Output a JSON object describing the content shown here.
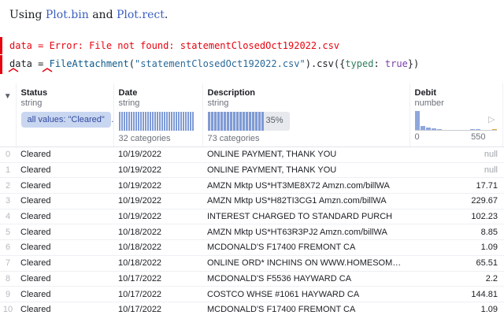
{
  "intro": {
    "prefix": "Using ",
    "link1": "Plot.bin",
    "middle": " and ",
    "link2": "Plot.rect",
    "suffix": "."
  },
  "error_cell": {
    "message": "data = Error: File not found: statementClosedOct192022.csv"
  },
  "code_cell": {
    "var": "data",
    "eq": " = ",
    "fn": "FileAttachment",
    "open": "(",
    "str": "\"statementClosedOct192022.csv\"",
    "mid": ").csv({",
    "key": "typed",
    "colon": ": ",
    "kw": "true",
    "close": "})"
  },
  "table": {
    "columns": [
      {
        "name": "Status",
        "type": "string",
        "summary_pill": "all values: \"Cleared\""
      },
      {
        "name": "Date",
        "type": "string",
        "summary": "32 categories"
      },
      {
        "name": "Description",
        "type": "string",
        "summary": "73 categories",
        "top_share_label": "35%",
        "top_share": 0.35
      },
      {
        "name": "Debit",
        "type": "number",
        "hist_min": "0",
        "hist_max": "550"
      }
    ],
    "rows": [
      {
        "idx": "0",
        "status": "Cleared",
        "date": "10/19/2022",
        "desc": "ONLINE PAYMENT, THANK YOU",
        "debit": "null"
      },
      {
        "idx": "1",
        "status": "Cleared",
        "date": "10/19/2022",
        "desc": "ONLINE PAYMENT, THANK YOU",
        "debit": "null"
      },
      {
        "idx": "2",
        "status": "Cleared",
        "date": "10/19/2022",
        "desc": "AMZN Mktp US*HT3ME8X72 Amzn.com/billWA",
        "debit": "17.71"
      },
      {
        "idx": "3",
        "status": "Cleared",
        "date": "10/19/2022",
        "desc": "AMZN Mktp US*H82TI3CG1 Amzn.com/billWA",
        "debit": "229.67"
      },
      {
        "idx": "4",
        "status": "Cleared",
        "date": "10/19/2022",
        "desc": "INTEREST CHARGED TO STANDARD PURCH",
        "debit": "102.23"
      },
      {
        "idx": "5",
        "status": "Cleared",
        "date": "10/18/2022",
        "desc": "AMZN Mktp US*HT63R3PJ2 Amzn.com/billWA",
        "debit": "8.85"
      },
      {
        "idx": "6",
        "status": "Cleared",
        "date": "10/18/2022",
        "desc": "MCDONALD'S F17400 FREMONT CA",
        "debit": "1.09"
      },
      {
        "idx": "7",
        "status": "Cleared",
        "date": "10/18/2022",
        "desc": "ONLINE ORD* INCHINS ON WWW.HOMESOME.CA",
        "debit": "65.51"
      },
      {
        "idx": "8",
        "status": "Cleared",
        "date": "10/17/2022",
        "desc": "MCDONALD'S F5536 HAYWARD CA",
        "debit": "2.2"
      },
      {
        "idx": "9",
        "status": "Cleared",
        "date": "10/17/2022",
        "desc": "COSTCO WHSE #1061 HAYWARD CA",
        "debit": "144.81"
      },
      {
        "idx": "10",
        "status": "Cleared",
        "date": "10/17/2022",
        "desc": "MCDONALD'S F17400 FREMONT CA",
        "debit": "1.09"
      }
    ]
  },
  "colors": {
    "error": "#e7040f",
    "link": "#3b5fc0",
    "bar": "#7f9bd6",
    "pill_bg": "#c9d6f0"
  },
  "icons": {
    "run": "play-icon",
    "expand": "chevron-down-icon",
    "error_marker": "caret-up-icon"
  }
}
